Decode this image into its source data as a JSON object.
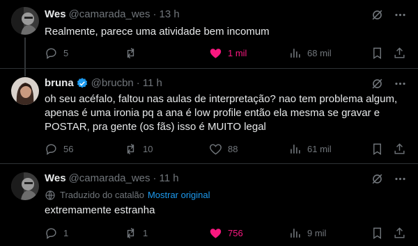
{
  "tweets": [
    {
      "name": "Wes",
      "handle": "@camarada_wes",
      "time": "13 h",
      "text": "Realmente, parece uma atividade bem incomum",
      "replies": "5",
      "retweets": "",
      "likes": "1 mil",
      "views": "68 mil",
      "liked": true
    },
    {
      "name": "bruna",
      "handle": "@brucbn",
      "time": "11 h",
      "text": "oh seu acéfalo, faltou nas aulas de interpretação? nao tem problema algum, apenas é uma ironia pq a ana é low profile então ela mesma se gravar e POSTAR, pra gente (os fãs) isso é MUITO legal",
      "replies": "56",
      "retweets": "10",
      "likes": "88",
      "views": "61 mil",
      "liked": false
    },
    {
      "name": "Wes",
      "handle": "@camarada_wes",
      "time": "11 h",
      "translated_label": "Traduzido do catalão",
      "show_original": "Mostrar original",
      "text": "extremamente estranha",
      "replies": "1",
      "retweets": "1",
      "likes": "756",
      "views": "9 mil",
      "liked": true
    }
  ],
  "colors": {
    "like": "#f91880",
    "link": "#1d9bf0",
    "verified": "#1d9bf0",
    "muted": "#71767b"
  }
}
